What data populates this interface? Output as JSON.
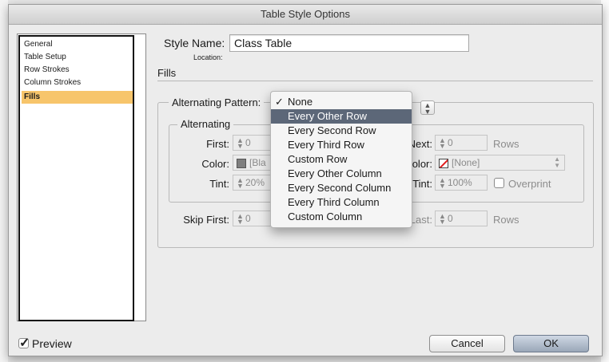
{
  "window": {
    "title": "Table Style Options"
  },
  "sidebar": {
    "items": [
      {
        "label": "General"
      },
      {
        "label": "Table Setup"
      },
      {
        "label": "Row Strokes"
      },
      {
        "label": "Column Strokes"
      },
      {
        "label": "Fills",
        "selected": true
      }
    ]
  },
  "style_name": {
    "label": "Style Name:",
    "value": "Class Table"
  },
  "location": {
    "label": "Location:"
  },
  "section": {
    "title": "Fills"
  },
  "alternating_pattern": {
    "label": "Alternating Pattern:",
    "options": [
      {
        "label": "None",
        "checked": true
      },
      {
        "label": "Every Other Row",
        "highlighted": true
      },
      {
        "label": "Every Second Row"
      },
      {
        "label": "Every Third Row"
      },
      {
        "label": "Custom Row"
      },
      {
        "label": "Every Other Column"
      },
      {
        "label": "Every Second Column"
      },
      {
        "label": "Every Third Column"
      },
      {
        "label": "Custom Column"
      }
    ]
  },
  "alternating": {
    "title": "Alternating",
    "first": {
      "label": "First:",
      "value": "0"
    },
    "next": {
      "label": "Next:",
      "value": "0",
      "unit": "Rows"
    },
    "color1": {
      "label": "Color:",
      "value": "[Bla"
    },
    "color2": {
      "label": "Color:",
      "value": "[None]"
    },
    "tint1": {
      "label": "Tint:",
      "value": "20%"
    },
    "tint2": {
      "label": "Tint:",
      "value": "100%"
    },
    "overprint": {
      "label": "Overprint",
      "checked": false
    }
  },
  "skip": {
    "first": {
      "label": "Skip First:",
      "value": "0"
    },
    "last": {
      "label": "Skip Last:",
      "value": "0",
      "unit": "Rows"
    }
  },
  "preview": {
    "label": "Preview",
    "checked": true
  },
  "buttons": {
    "cancel": "Cancel",
    "ok": "OK"
  },
  "colors": {
    "selection": "#f7c56b",
    "menu_highlight": "#5c6778"
  }
}
